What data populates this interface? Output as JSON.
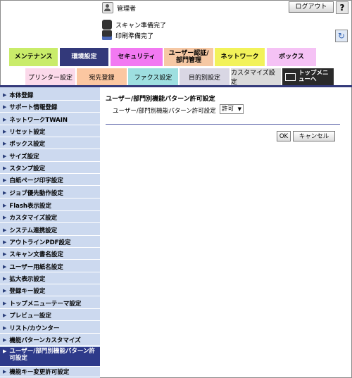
{
  "header": {
    "user_label": "管理者",
    "logout_label": "ログアウト",
    "help_label": "?",
    "refresh_label": "↻",
    "scan_status": "スキャン準備完了",
    "print_status": "印刷準備完了"
  },
  "tabs": [
    {
      "label": "メンテナンス"
    },
    {
      "label": "環境設定"
    },
    {
      "label": "セキュリティ"
    },
    {
      "label": "ユーザー認証/部門管理"
    },
    {
      "label": "ネットワーク"
    },
    {
      "label": "ボックス"
    }
  ],
  "subtabs": [
    {
      "label": "プリンター設定"
    },
    {
      "label": "宛先登録"
    },
    {
      "label": "ファクス設定"
    },
    {
      "label": "目的別設定"
    },
    {
      "label": "カスタマイズ設定"
    },
    {
      "label": "トップメニューへ"
    }
  ],
  "sidebar": {
    "items": [
      {
        "label": "本体登録"
      },
      {
        "label": "サポート情報登録"
      },
      {
        "label": "ネットワークTWAIN"
      },
      {
        "label": "リセット設定"
      },
      {
        "label": "ボックス設定"
      },
      {
        "label": "サイズ設定"
      },
      {
        "label": "スタンプ設定"
      },
      {
        "label": "白紙ページ印字設定"
      },
      {
        "label": "ジョブ優先動作設定"
      },
      {
        "label": "Flash表示設定"
      },
      {
        "label": "カスタマイズ設定"
      },
      {
        "label": "システム連携設定"
      },
      {
        "label": "アウトラインPDF設定"
      },
      {
        "label": "スキャン文書名設定"
      },
      {
        "label": "ユーザー用紙名設定"
      },
      {
        "label": "拡大表示設定"
      },
      {
        "label": "登録キー設定"
      },
      {
        "label": "トップメニューテーマ設定"
      },
      {
        "label": "プレビュー設定"
      },
      {
        "label": "リスト/カウンター"
      },
      {
        "label": "機能パターンカスタマイズ"
      },
      {
        "label": "ユーザー/部門別機能パターン許可設定"
      },
      {
        "label": "機能キー変更許可設定"
      }
    ]
  },
  "main": {
    "title": "ユーザー/部門別機能パターン許可設定",
    "field_label": "ユーザー/部門別機能パターン許可設定",
    "select_value": "許可",
    "ok_label": "OK",
    "cancel_label": "キャンセル"
  },
  "colors": {
    "accent": "#33397a",
    "sidebar_bg": "#ccd9ef",
    "active_item": "#2e3a8a"
  }
}
